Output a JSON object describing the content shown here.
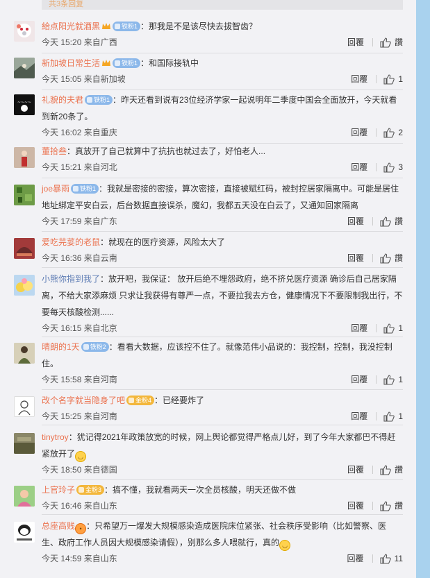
{
  "top_box_text": "共3条回复",
  "ui": {
    "reply_label": "回覆",
    "like_label": "讚"
  },
  "comments": [
    {
      "username": "給点阳光就酒黑",
      "badge": "铁粉1",
      "sep": "：",
      "text": "那我是不是该尽快去拔智齿？",
      "meta": "今天 15:20 来自广西",
      "likes": ""
    },
    {
      "username": "新加坡日常生活",
      "badge": "铁粉1",
      "sep": "：",
      "text": "和国际接轨中",
      "meta": "今天 15:05 来自新加坡",
      "likes": "1"
    },
    {
      "username": "礼貌的夫君",
      "badge": "铁粉1",
      "sep": "：",
      "text": "昨天还看到说有23位经济学家一起说明年二季度中国会全面放开，今天就看到新20条了。",
      "meta": "今天 16:02 来自重庆",
      "likes": "2"
    },
    {
      "username": "董拾叁",
      "badge": "",
      "sep": "：",
      "text": "真放开了自己就算中了抗抗也就过去了，好怕老人...",
      "meta": "今天 15:21 来自河北",
      "likes": "3"
    },
    {
      "username": "joe暴雨",
      "badge": "铁粉1",
      "sep": "：",
      "text": "我就是密接的密接，算次密接，直接被赋红码，被封控居家隔离中。可能是居住地址綁定平安白云，后台数据直接误杀，魔幻，我都五天没在白云了，又通知回家隔离",
      "meta": "今天 17:59 来自广东",
      "likes": ""
    },
    {
      "username": "爱吃芫荽的老鼠",
      "badge": "",
      "sep": "：",
      "text": "就现在的医疗资源，风险太大了",
      "meta": "今天 16:36 来自云南",
      "likes": ""
    },
    {
      "username": "小熊你指到我了",
      "badge": "",
      "sep": "：",
      "text": "放开吧，我保证： 放开后绝不埋怨政府，绝不挤兑医疗资源 确诊后自己居家隔离，不给大家添麻烦 只求让我获得有尊严一点，不要拉我去方仓，健康情况下不要限制我出行，不要每天核酸检测......",
      "meta": "今天 16:15 来自北京",
      "likes": "1"
    },
    {
      "username": "晴朗的1天",
      "badge": "铁粉2",
      "sep": "：",
      "text": "看看大数据，应该控不住了。就像范伟小品说的：我控制，控制，我没控制住。",
      "meta": "今天 15:58 来自河南",
      "likes": "1"
    },
    {
      "username": "改个名字就当隐身了吧",
      "badge": "金粉4",
      "sep": "：",
      "text": "已经要炸了",
      "meta": "今天 15:25 来自河南",
      "likes": "1"
    },
    {
      "username": "tinytroy",
      "badge": "",
      "sep": "：",
      "text": "犹记得2021年政策放宽的时候，网上舆论都觉得严格点儿好，到了今年大家都巴不得赶紧放开了",
      "meta": "今天 18:50 来自德国",
      "likes": ""
    },
    {
      "username": "上官玲子",
      "badge": "金粉3",
      "sep": "：",
      "text": "搞不懂，我就看两天一次全员核酸，明天还做不做",
      "meta": "今天 16:46 来自山东",
      "likes": ""
    },
    {
      "username": "总座高贱",
      "badge": "",
      "sep": "：",
      "text": "只希望万一爆发大规模感染造成医院床位紧张、社会秩序受影响（比如警察、医生、政府工作人员因大规模感染请假），别那么多人喂就行，真的",
      "meta": "今天 14:59 来自山东",
      "likes": "11"
    }
  ]
}
